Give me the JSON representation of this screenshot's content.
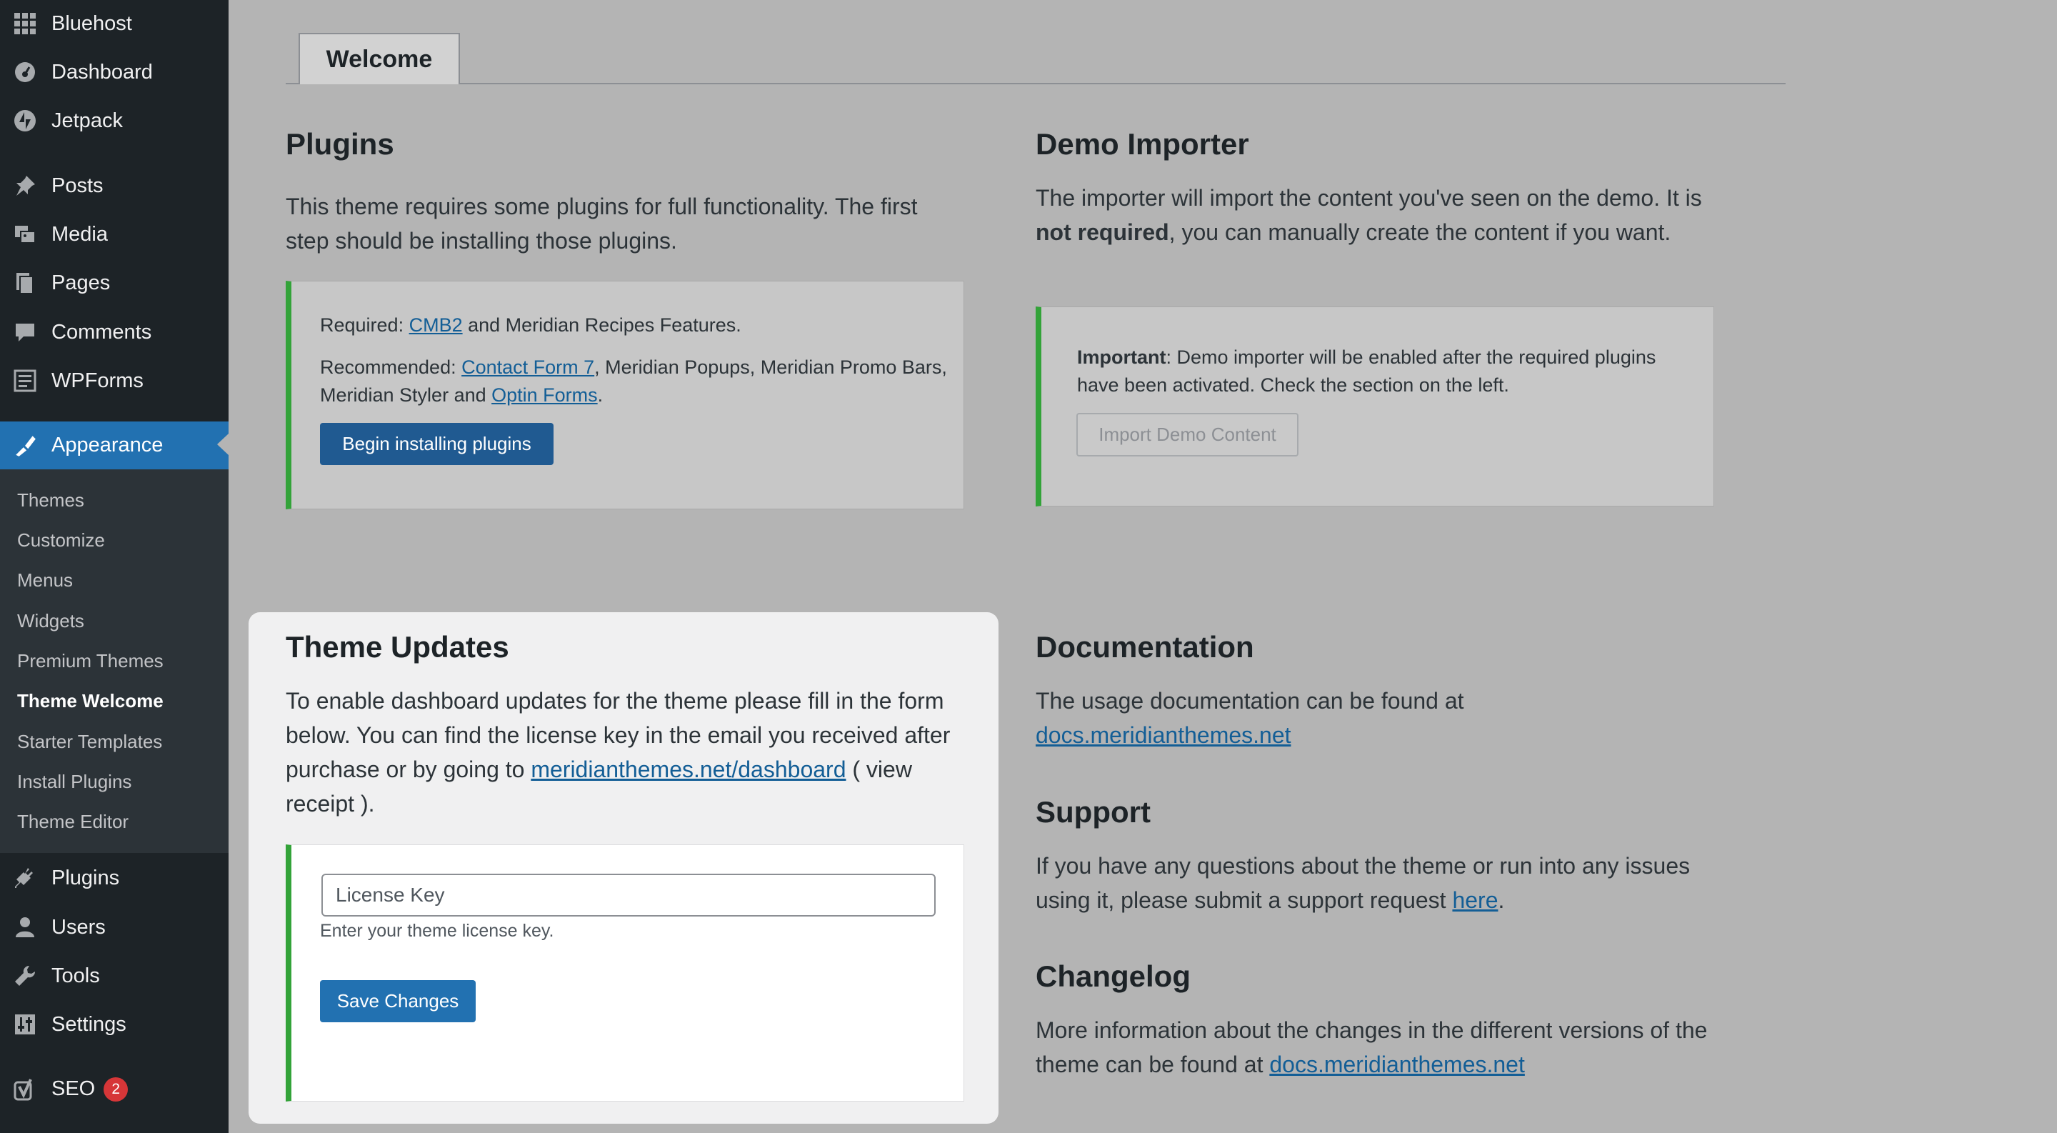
{
  "sidebar": {
    "items": [
      {
        "label": "Bluehost",
        "icon": "grid-icon"
      },
      {
        "label": "Dashboard",
        "icon": "dashboard-icon"
      },
      {
        "label": "Jetpack",
        "icon": "jetpack-icon"
      },
      {
        "label": "Posts",
        "icon": "pin-icon"
      },
      {
        "label": "Media",
        "icon": "media-icon"
      },
      {
        "label": "Pages",
        "icon": "pages-icon"
      },
      {
        "label": "Comments",
        "icon": "comment-icon"
      },
      {
        "label": "WPForms",
        "icon": "forms-icon"
      },
      {
        "label": "Appearance",
        "icon": "brush-icon"
      },
      {
        "label": "Plugins",
        "icon": "plug-icon"
      },
      {
        "label": "Users",
        "icon": "user-icon"
      },
      {
        "label": "Tools",
        "icon": "wrench-icon"
      },
      {
        "label": "Settings",
        "icon": "settings-icon"
      },
      {
        "label": "SEO",
        "icon": "yoast-icon",
        "badge": "2"
      }
    ],
    "submenu": [
      "Themes",
      "Customize",
      "Menus",
      "Widgets",
      "Premium Themes",
      "Theme Welcome",
      "Starter Templates",
      "Install Plugins",
      "Theme Editor"
    ],
    "active_submenu": "Theme Welcome"
  },
  "tab": {
    "label": "Welcome"
  },
  "plugins": {
    "title": "Plugins",
    "intro": "This theme requires some plugins for full functionality. The first step should be installing those plugins.",
    "required_prefix": "Required: ",
    "required_link": "CMB2",
    "required_suffix": " and Meridian Recipes Features.",
    "recommended_prefix": "Recommended: ",
    "recommended_link1": "Contact Form 7",
    "recommended_middle": ", Meridian Popups, Meridian Promo Bars, Meridian Styler and ",
    "recommended_link2": "Optin Forms",
    "recommended_suffix": ".",
    "button": "Begin installing plugins"
  },
  "demo": {
    "title": "Demo Importer",
    "intro_part1": "The importer will import the content you've seen on the demo. It is ",
    "intro_bold": "not required",
    "intro_part2": ", you can manually create the content if you want.",
    "notice_bold": "Important",
    "notice_text": ": Demo importer will be enabled after the required plugins have been activated. Check the section on the left.",
    "button": "Import Demo Content"
  },
  "theme_updates": {
    "title": "Theme Updates",
    "text": "To enable dashboard updates for the theme please fill in the form below. You can find the license key in the email you received after purchase or by going to ",
    "link": "meridianthemes.net/dashboard",
    "suffix": " ( view receipt ).",
    "placeholder": "License Key",
    "help": "Enter your theme license key.",
    "button": "Save Changes"
  },
  "documentation": {
    "title": "Documentation",
    "text": "The usage documentation can be found at ",
    "link": "docs.meridianthemes.net"
  },
  "support": {
    "title": "Support",
    "text": "If you have any questions about the theme or run into any issues using it, please submit a support request ",
    "link": "here",
    "suffix": "."
  },
  "changelog": {
    "title": "Changelog",
    "text": "More information about the changes in the different versions of the theme can be found at ",
    "link": "docs.meridianthemes.net"
  },
  "colors": {
    "sidebar": "#1d2327",
    "accent": "#2271b1",
    "notice_border": "#33a339",
    "badge": "#d63638"
  }
}
